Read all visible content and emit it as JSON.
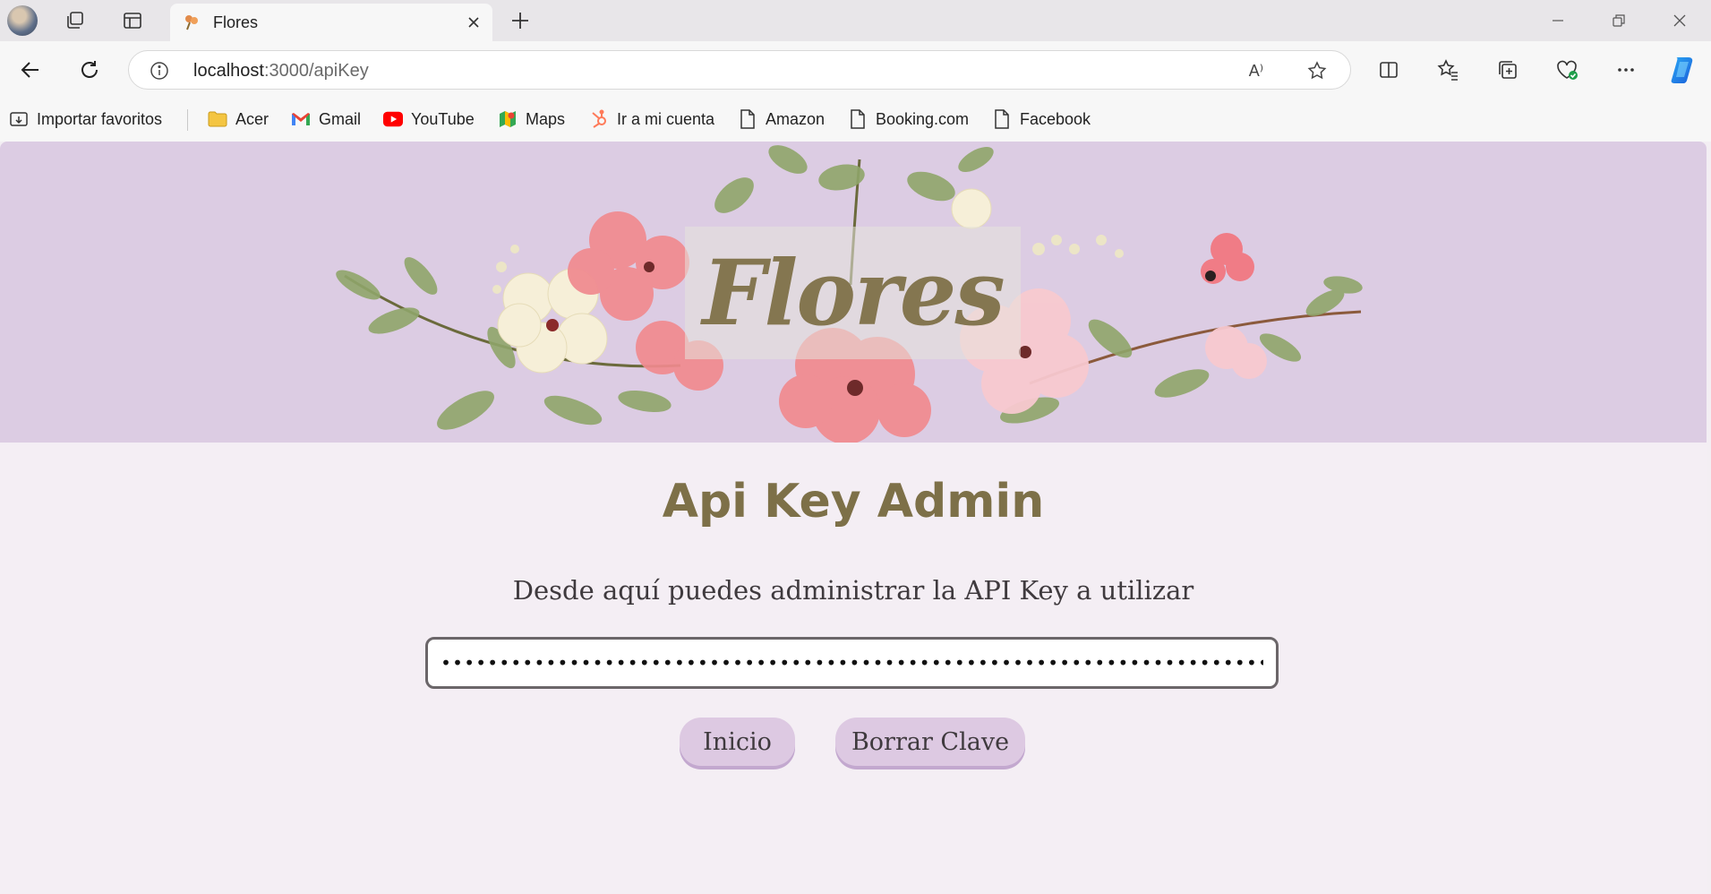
{
  "browser": {
    "tab_title": "Flores",
    "url_host": "localhost",
    "url_path": ":3000/apiKey",
    "read_aloud_label": "A⁾",
    "bookmarks": [
      {
        "label": "Importar favoritos",
        "icon": "import-icon"
      },
      {
        "label": "Acer",
        "icon": "folder-icon"
      },
      {
        "label": "Gmail",
        "icon": "gmail-icon"
      },
      {
        "label": "YouTube",
        "icon": "youtube-icon"
      },
      {
        "label": "Maps",
        "icon": "maps-icon"
      },
      {
        "label": "Ir a mi cuenta",
        "icon": "hubspot-icon"
      },
      {
        "label": "Amazon",
        "icon": "page-icon"
      },
      {
        "label": "Booking.com",
        "icon": "page-icon"
      },
      {
        "label": "Facebook",
        "icon": "page-icon"
      }
    ]
  },
  "page": {
    "logo_text": "Flores",
    "heading": "Api Key Admin",
    "subtitle": "Desde aquí puedes administrar la API Key a utilizar",
    "api_key_value": "••••••••••••••••••••••••••••••••••••••••••••••••••••••••••••••••••••••••••••••••••••••••••••••••••",
    "buttons": {
      "home": "Inicio",
      "delete_key": "Borrar Clave"
    }
  },
  "colors": {
    "hero_background": "#dccce3",
    "heading": "#7d7048",
    "button": "#ddc9e2",
    "page_background": "#f4eef4"
  }
}
